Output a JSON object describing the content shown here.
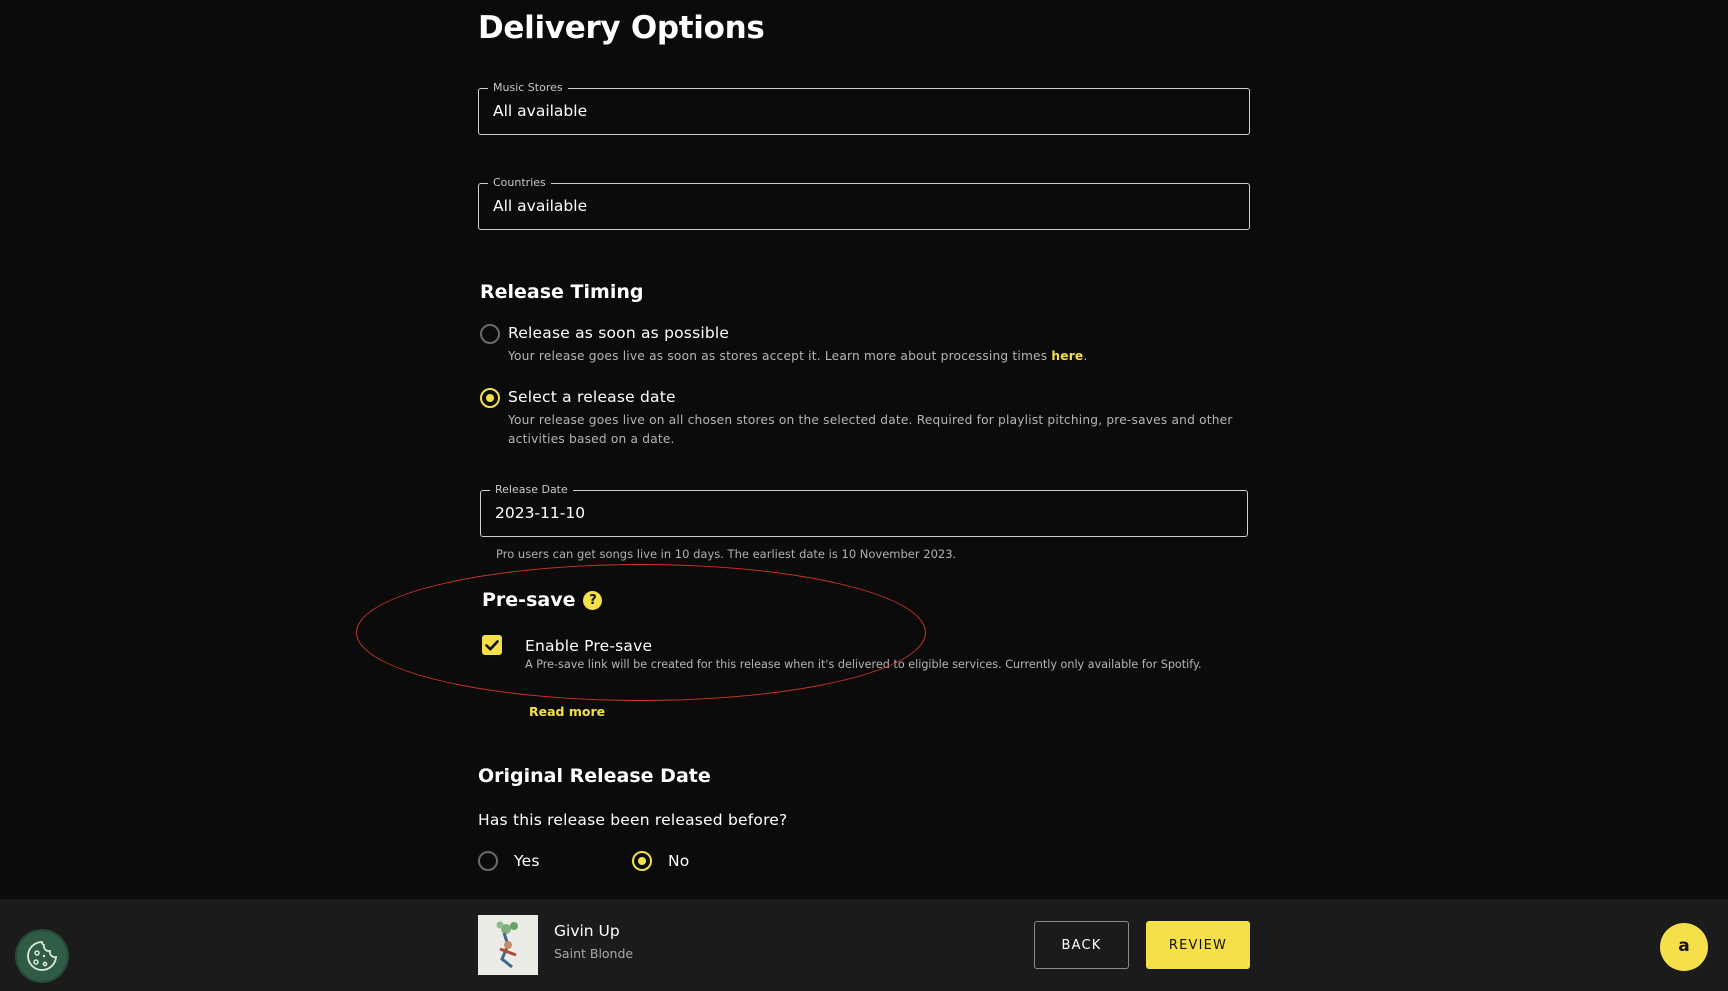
{
  "header": {
    "title": "Delivery Options"
  },
  "delivery": {
    "music_stores": {
      "label": "Music Stores",
      "value": "All available"
    },
    "countries": {
      "label": "Countries",
      "value": "All available"
    }
  },
  "release_timing": {
    "heading": "Release Timing",
    "options": [
      {
        "label": "Release as soon as possible",
        "description": "Your release goes live as soon as stores accept it. Learn more about processing times ",
        "link_text": "here",
        "suffix": ".",
        "selected": false
      },
      {
        "label": "Select a release date",
        "description": "Your release goes live on all chosen stores on the selected date. Required for playlist pitching, pre-saves and other activities based on a date.",
        "selected": true
      }
    ],
    "release_date": {
      "label": "Release Date",
      "value": "2023-11-10",
      "helper": "Pro users can get songs live in 10 days. The earliest date is 10 November 2023."
    }
  },
  "presave": {
    "heading": "Pre-save",
    "help_glyph": "?",
    "checkbox_label": "Enable Pre-save",
    "checked": true,
    "description": "A Pre-save link will be created for this release when it's delivered to eligible services. Currently only available for Spotify.",
    "read_more": "Read more"
  },
  "original_release": {
    "heading": "Original Release Date",
    "question": "Has this release been released before?",
    "options": [
      {
        "label": "Yes",
        "selected": false
      },
      {
        "label": "No",
        "selected": true
      }
    ]
  },
  "footer": {
    "track_title": "Givin Up",
    "artist": "Saint Blonde",
    "back_label": "BACK",
    "review_label": "REVIEW",
    "chat_glyph": "a"
  },
  "colors": {
    "background": "#0b0b0b",
    "accent": "#f5e04a",
    "footer": "#1b1b1b",
    "annotation": "#d0342c"
  },
  "icons": {
    "cookie": "cookie-icon",
    "help": "question-icon",
    "check": "check-icon"
  }
}
